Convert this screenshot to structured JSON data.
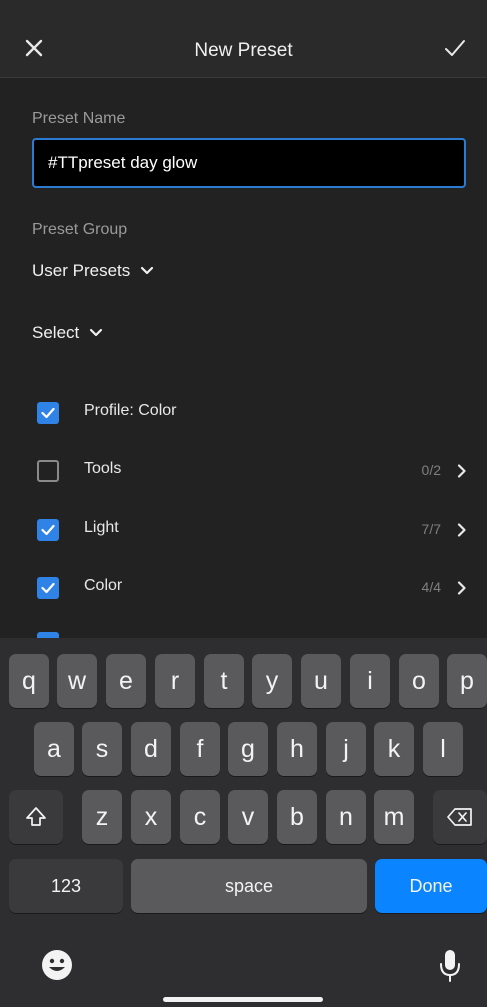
{
  "header": {
    "title": "New Preset"
  },
  "preset_name": {
    "label": "Preset Name",
    "value": "#TTpreset day glow"
  },
  "preset_group": {
    "label": "Preset Group",
    "value": "User Presets"
  },
  "select": {
    "label": "Select"
  },
  "settings": [
    {
      "label": "Profile: Color",
      "checked": true,
      "count": ""
    },
    {
      "label": "Tools",
      "checked": false,
      "count": "0/2"
    },
    {
      "label": "Light",
      "checked": true,
      "count": "7/7"
    },
    {
      "label": "Color",
      "checked": true,
      "count": "4/4"
    }
  ],
  "keyboard": {
    "row1": [
      "q",
      "w",
      "e",
      "r",
      "t",
      "y",
      "u",
      "i",
      "o",
      "p"
    ],
    "row2": [
      "a",
      "s",
      "d",
      "f",
      "g",
      "h",
      "j",
      "k",
      "l"
    ],
    "row3": [
      "z",
      "x",
      "c",
      "v",
      "b",
      "n",
      "m"
    ],
    "numbers_label": "123",
    "space_label": "space",
    "done_label": "Done"
  },
  "colors": {
    "accent": "#2f83e6",
    "done": "#0a84ff",
    "background": "#222222"
  }
}
